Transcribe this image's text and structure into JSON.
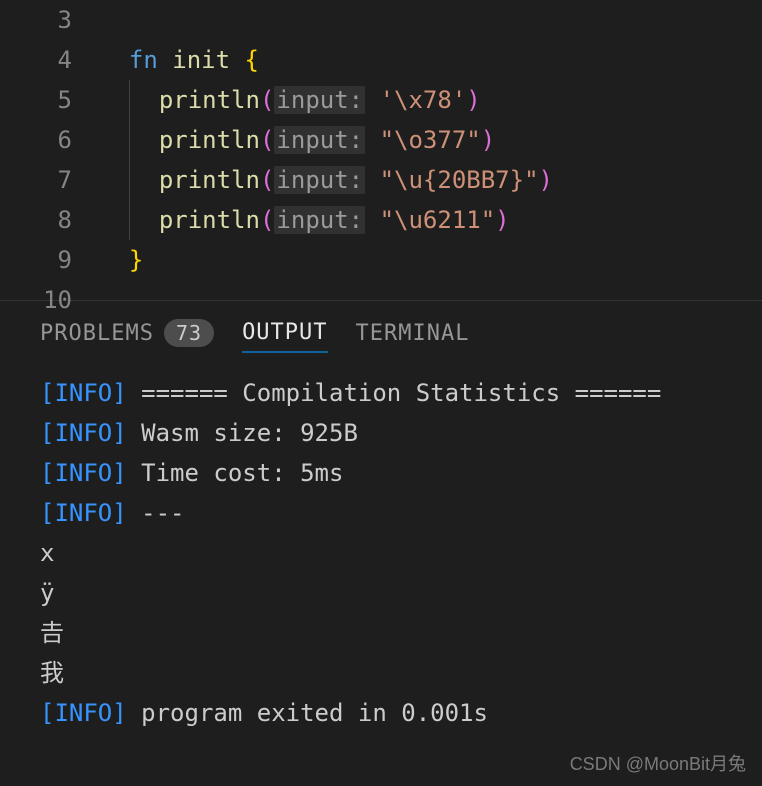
{
  "editor": {
    "lines": [
      {
        "num": "3",
        "tokens": []
      },
      {
        "num": "4",
        "tokens": [
          {
            "cls": "",
            "t": "  "
          },
          {
            "cls": "kw",
            "t": "fn"
          },
          {
            "cls": "",
            "t": " "
          },
          {
            "cls": "fn-name",
            "t": "init"
          },
          {
            "cls": "",
            "t": " "
          },
          {
            "cls": "brace",
            "t": "{"
          }
        ]
      },
      {
        "num": "5",
        "tokens": [
          {
            "cls": "",
            "t": "  "
          },
          {
            "cls": "guide",
            "t": ""
          },
          {
            "cls": "",
            "t": "  "
          },
          {
            "cls": "call",
            "t": "println"
          },
          {
            "cls": "paren2",
            "t": "("
          },
          {
            "cls": "param-hint",
            "t": "input:"
          },
          {
            "cls": "",
            "t": " "
          },
          {
            "cls": "char",
            "t": "'\\x78'"
          },
          {
            "cls": "paren2",
            "t": ")"
          }
        ]
      },
      {
        "num": "6",
        "tokens": [
          {
            "cls": "",
            "t": "  "
          },
          {
            "cls": "guide",
            "t": ""
          },
          {
            "cls": "",
            "t": "  "
          },
          {
            "cls": "call",
            "t": "println"
          },
          {
            "cls": "paren2",
            "t": "("
          },
          {
            "cls": "param-hint",
            "t": "input:"
          },
          {
            "cls": "",
            "t": " "
          },
          {
            "cls": "str",
            "t": "\"\\o377\""
          },
          {
            "cls": "paren2",
            "t": ")"
          }
        ]
      },
      {
        "num": "7",
        "tokens": [
          {
            "cls": "",
            "t": "  "
          },
          {
            "cls": "guide",
            "t": ""
          },
          {
            "cls": "",
            "t": "  "
          },
          {
            "cls": "call",
            "t": "println"
          },
          {
            "cls": "paren2",
            "t": "("
          },
          {
            "cls": "param-hint",
            "t": "input:"
          },
          {
            "cls": "",
            "t": " "
          },
          {
            "cls": "str",
            "t": "\"\\u{20BB7}\""
          },
          {
            "cls": "paren2",
            "t": ")"
          }
        ]
      },
      {
        "num": "8",
        "tokens": [
          {
            "cls": "",
            "t": "  "
          },
          {
            "cls": "guide",
            "t": ""
          },
          {
            "cls": "",
            "t": "  "
          },
          {
            "cls": "call",
            "t": "println"
          },
          {
            "cls": "paren2",
            "t": "("
          },
          {
            "cls": "param-hint",
            "t": "input:"
          },
          {
            "cls": "",
            "t": " "
          },
          {
            "cls": "str",
            "t": "\"\\u6211\""
          },
          {
            "cls": "paren2",
            "t": ")"
          }
        ]
      },
      {
        "num": "9",
        "tokens": [
          {
            "cls": "",
            "t": "  "
          },
          {
            "cls": "brace",
            "t": "}"
          }
        ]
      },
      {
        "num": "10",
        "tokens": []
      }
    ]
  },
  "panel": {
    "tabs": {
      "problems": {
        "label": "PROBLEMS",
        "badge": "73"
      },
      "output": {
        "label": "OUTPUT"
      },
      "terminal": {
        "label": "TERMINAL"
      }
    },
    "output_lines": [
      {
        "prefix": "[INFO]",
        "text": " ====== Compilation Statistics ======"
      },
      {
        "prefix": "[INFO]",
        "text": " Wasm size: 925B"
      },
      {
        "prefix": "[INFO]",
        "text": " Time cost: 5ms"
      },
      {
        "prefix": "[INFO]",
        "text": " ---"
      },
      {
        "prefix": "",
        "text": ""
      },
      {
        "prefix": "",
        "text": "x"
      },
      {
        "prefix": "",
        "text": "ÿ"
      },
      {
        "prefix": "",
        "text": "𠮷"
      },
      {
        "prefix": "",
        "text": "我"
      },
      {
        "prefix": "[INFO]",
        "text": " program exited in 0.001s"
      }
    ]
  },
  "watermark": "CSDN @MoonBit月兔"
}
